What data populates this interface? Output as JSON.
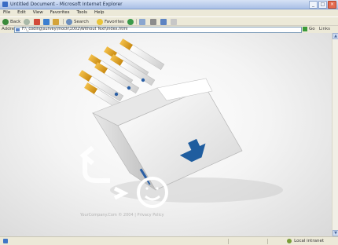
{
  "window": {
    "title": "Untitled Document - Microsoft Internet Explorer"
  },
  "menu": {
    "items": [
      "File",
      "Edit",
      "View",
      "Favorites",
      "Tools",
      "Help"
    ]
  },
  "toolbar": {
    "back_label": "Back",
    "search_label": "Search",
    "favorites_label": "Favorites"
  },
  "address": {
    "label": "Address",
    "url": "F:\\_coding\\survey\\mock\\1002\\Without Text\\index.html",
    "go_label": "Go",
    "links_label": "Links"
  },
  "page": {
    "footer": "YourCompany.Com © 2004 | Privacy Policy"
  },
  "status": {
    "zone": "Local intranet"
  },
  "colors": {
    "accent_blue": "#1f5d9f",
    "filter_orange": "#e6a21a",
    "titlebar": "#a9bfe6"
  }
}
